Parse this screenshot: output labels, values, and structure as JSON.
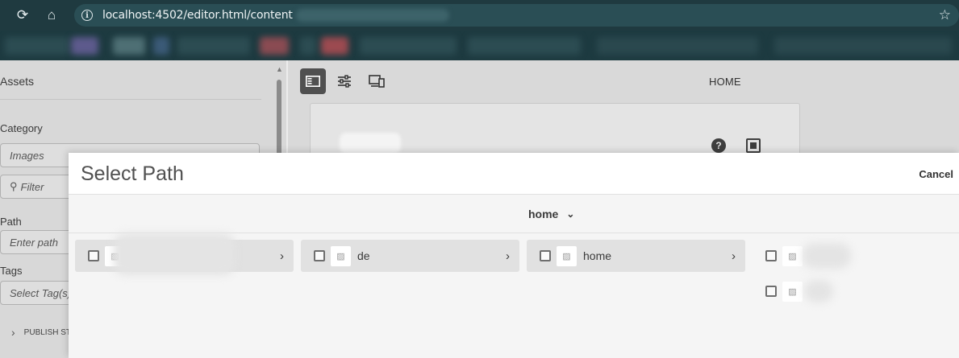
{
  "browser": {
    "url": "localhost:4502/editor.html/content",
    "icons": [
      "reload-icon",
      "home-icon",
      "info-icon",
      "star-icon"
    ]
  },
  "left_panel": {
    "title": "Assets",
    "category_label": "Category",
    "category_value": "Images",
    "filter_placeholder": "Filter",
    "path_label": "Path",
    "path_placeholder": "Enter path",
    "tags_label": "Tags",
    "tags_placeholder": "Select Tag(s)",
    "publish_label": "PUBLISH ST"
  },
  "editor": {
    "page_label": "HOME"
  },
  "dialog": {
    "title": "Select Path",
    "cancel_label": "Cancel",
    "breadcrumb": "home",
    "columns": [
      {
        "label": "",
        "has_children": true
      },
      {
        "label": "de",
        "has_children": true
      },
      {
        "label": "home",
        "has_children": true
      }
    ],
    "last_column_items": [
      {
        "label": ""
      },
      {
        "label": ""
      }
    ]
  },
  "colors": {
    "chrome_bg": "#1f3a40",
    "dialog_bg": "#f5f5f5",
    "item_bg": "#e1e1e1",
    "active_tool": "#505050"
  }
}
